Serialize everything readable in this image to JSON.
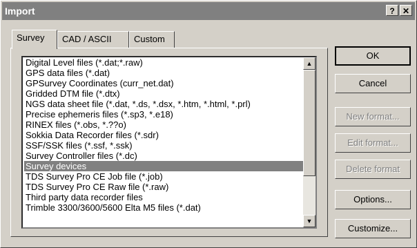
{
  "window": {
    "title": "Import",
    "help_label": "?",
    "close_label": "✕"
  },
  "tabs": [
    {
      "label": "Survey",
      "active": true
    },
    {
      "label": "CAD / ASCII",
      "active": false
    },
    {
      "label": "Custom",
      "active": false
    }
  ],
  "list": {
    "items": [
      "Digital Level files (*.dat;*.raw)",
      "GPS data files (*.dat)",
      "GPSurvey Coordinates (curr_net.dat)",
      "Gridded DTM file (*.dtx)",
      "NGS data sheet file (*.dat, *.ds, *.dsx, *.htm, *.html, *.prl)",
      "Precise ephemeris files (*.sp3, *.e18)",
      "RINEX files (*.obs, *.??o)",
      "Sokkia Data Recorder files (*.sdr)",
      "SSF/SSK files (*.ssf, *.ssk)",
      "Survey Controller files (*.dc)",
      "Survey devices",
      "TDS Survey Pro CE Job file (*.job)",
      "TDS Survey Pro CE Raw file (*.raw)",
      "Third party data recorder files",
      "Trimble 3300/3600/5600 Elta M5 files (*.dat)"
    ],
    "selected_index": 10
  },
  "buttons": {
    "ok": "OK",
    "cancel": "Cancel",
    "new_format": "New format...",
    "edit_format": "Edit format...",
    "delete_format": "Delete format",
    "options": "Options...",
    "customize": "Customize..."
  }
}
